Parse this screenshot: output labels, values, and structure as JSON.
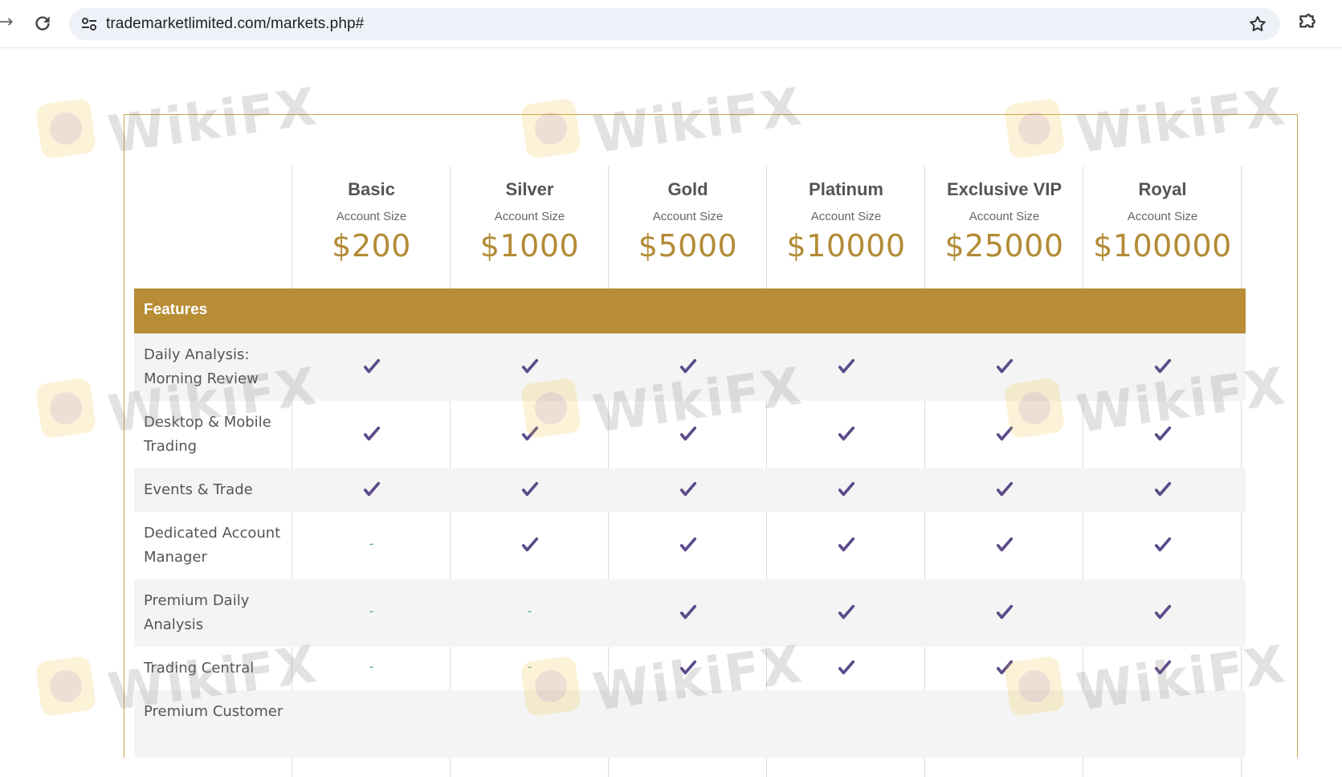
{
  "browser": {
    "url": "trademarketlimited.com/markets.php#"
  },
  "plans": [
    {
      "name": "Basic",
      "sub": "Account Size",
      "price": "$200"
    },
    {
      "name": "Silver",
      "sub": "Account Size",
      "price": "$1000"
    },
    {
      "name": "Gold",
      "sub": "Account Size",
      "price": "$5000"
    },
    {
      "name": "Platinum",
      "sub": "Account Size",
      "price": "$10000"
    },
    {
      "name": "Exclusive VIP",
      "sub": "Account Size",
      "price": "$25000"
    },
    {
      "name": "Royal",
      "sub": "Account Size",
      "price": "$100000"
    }
  ],
  "features_header": "Features",
  "features": [
    {
      "label": "Daily Analysis: Morning Review",
      "marks": [
        "check",
        "check",
        "check",
        "check",
        "check",
        "check"
      ]
    },
    {
      "label": "Desktop & Mobile Trading",
      "marks": [
        "check",
        "check",
        "check",
        "check",
        "check",
        "check"
      ]
    },
    {
      "label": "Events & Trade",
      "marks": [
        "check",
        "check",
        "check",
        "check",
        "check",
        "check"
      ]
    },
    {
      "label": "Dedicated Account Manager",
      "marks": [
        "-",
        "check",
        "check",
        "check",
        "check",
        "check"
      ]
    },
    {
      "label": "Premium Daily Analysis",
      "marks": [
        "-",
        "-",
        "check",
        "check",
        "check",
        "check"
      ]
    },
    {
      "label": "Trading Central",
      "marks": [
        "-",
        "-",
        "check",
        "check",
        "check",
        "check"
      ]
    },
    {
      "label": "Premium Customer",
      "marks": [
        "",
        "",
        "",
        "",
        "",
        ""
      ]
    }
  ],
  "watermark": {
    "text": "WikiFX"
  },
  "colors": {
    "accent": "#b88d35",
    "price": "#b38b36",
    "check": "#5b4b8a",
    "dash": "#5aa58a"
  }
}
